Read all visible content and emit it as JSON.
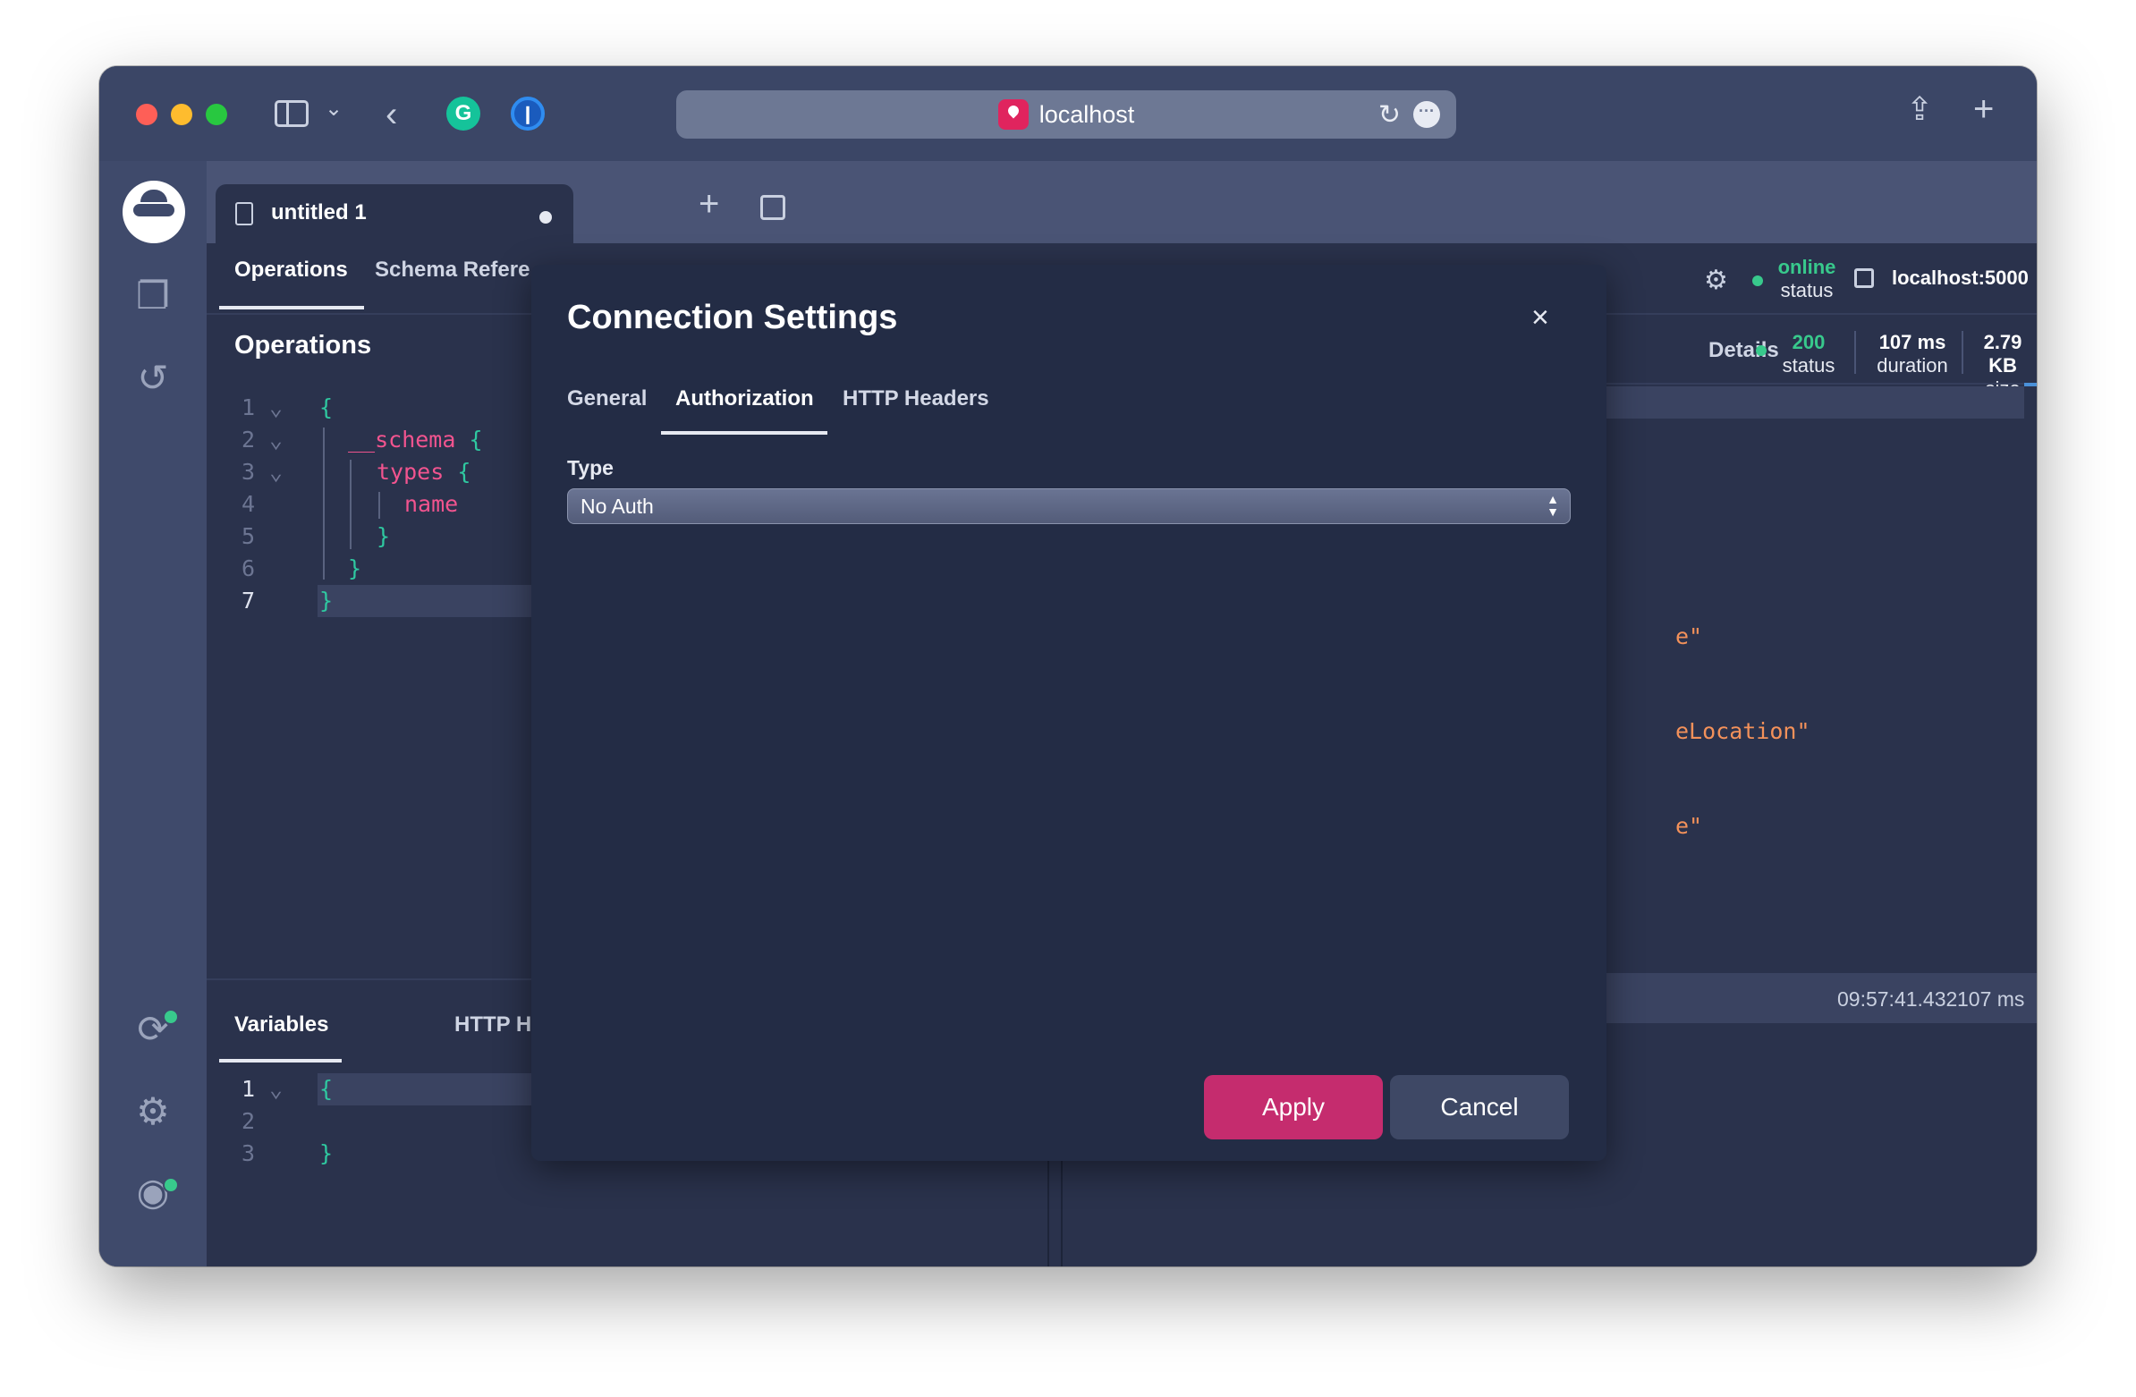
{
  "browser": {
    "url": "localhost",
    "icons": {
      "sidebar": "sidebar-icon",
      "back": "chevron-left-icon",
      "grammarly": "grammarly-icon",
      "onepassword": "onepassword-icon",
      "reload": "reload-icon",
      "more": "more-icon",
      "share": "share-icon",
      "newtab": "plus-icon"
    },
    "grammarly_letter": "G"
  },
  "document_tab": {
    "title": "untitled 1"
  },
  "left_panel": {
    "tabs": [
      "Operations",
      "Schema Refere"
    ],
    "header": "Operations",
    "code_lines": [
      {
        "n": "1",
        "text": "{"
      },
      {
        "n": "2",
        "kw": "__schema",
        "brace": "{"
      },
      {
        "n": "3",
        "kw": "types",
        "brace": "{"
      },
      {
        "n": "4",
        "kw": "name"
      },
      {
        "n": "5",
        "text": "}"
      },
      {
        "n": "6",
        "text": "}"
      },
      {
        "n": "7",
        "text": "}"
      }
    ]
  },
  "variables_panel": {
    "tabs": [
      "Variables",
      "HTTP Headers"
    ],
    "code_lines": [
      {
        "n": "1",
        "text": "{"
      },
      {
        "n": "2",
        "text": ""
      },
      {
        "n": "3",
        "text": "}"
      }
    ]
  },
  "right_panel": {
    "connection": {
      "status_value": "online",
      "status_label": "status",
      "host": "localhost:5000"
    },
    "details_tab": "Details",
    "stats": [
      {
        "value": "200",
        "label": "status",
        "accent": "#38c98c"
      },
      {
        "value": "107 ms",
        "label": "duration"
      },
      {
        "value": "2.79 KB",
        "label": "size"
      }
    ],
    "response_fragments": [
      "e\"",
      "eLocation\"",
      "e\""
    ],
    "history": {
      "time": "09:57:41.432",
      "duration": "107 ms"
    }
  },
  "modal": {
    "title": "Connection Settings",
    "tabs": [
      "General",
      "Authorization",
      "HTTP Headers"
    ],
    "active_tab": "Authorization",
    "type_label": "Type",
    "type_value": "No Auth",
    "apply_label": "Apply",
    "cancel_label": "Cancel",
    "apply_color": "#c52c6e"
  }
}
